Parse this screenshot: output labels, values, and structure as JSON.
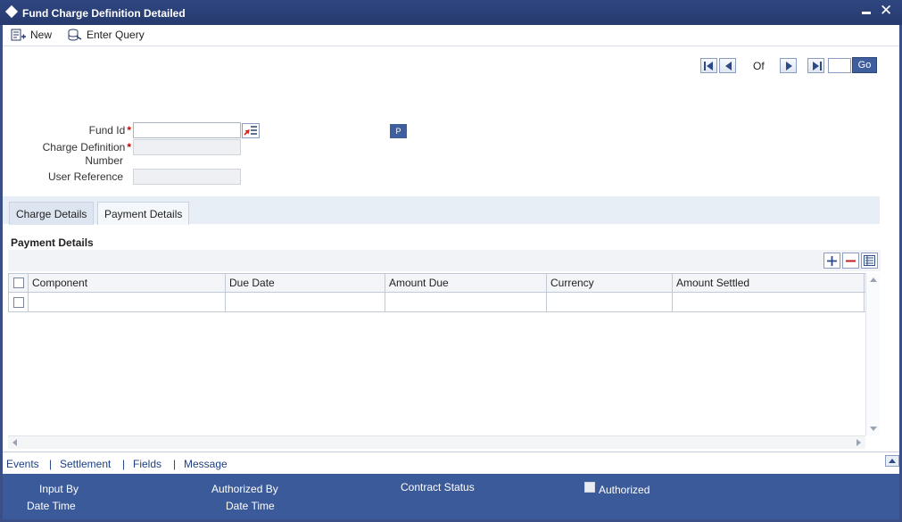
{
  "window": {
    "title": "Fund Charge Definition Detailed"
  },
  "toolbar": {
    "new_label": "New",
    "enter_query_label": "Enter Query"
  },
  "pager": {
    "of_label": "Of",
    "go_label": "Go"
  },
  "form": {
    "fund_id_label": "Fund Id",
    "charge_def_label_1": "Charge Definition",
    "charge_def_label_2": "Number",
    "user_ref_label": "User Reference",
    "required_mark": "*",
    "p_button_label": "P"
  },
  "tabs": [
    {
      "label": "Charge Details"
    },
    {
      "label": "Payment Details"
    }
  ],
  "section": {
    "title": "Payment Details"
  },
  "grid": {
    "columns": [
      "Component",
      "Due Date",
      "Amount Due",
      "Currency",
      "Amount Settled"
    ]
  },
  "footer_links": [
    "Events",
    "Settlement",
    "Fields",
    "Message"
  ],
  "footer_separator": "|",
  "audit": {
    "input_by": "Input By",
    "date_time_1": "Date Time",
    "authorized_by": "Authorized By",
    "date_time_2": "Date Time",
    "contract_status": "Contract Status",
    "authorized": "Authorized"
  },
  "colors": {
    "title_bar": "#2f4680",
    "audit_bar": "#3a5a99",
    "link": "#1d3f84",
    "required": "#cc0000"
  }
}
